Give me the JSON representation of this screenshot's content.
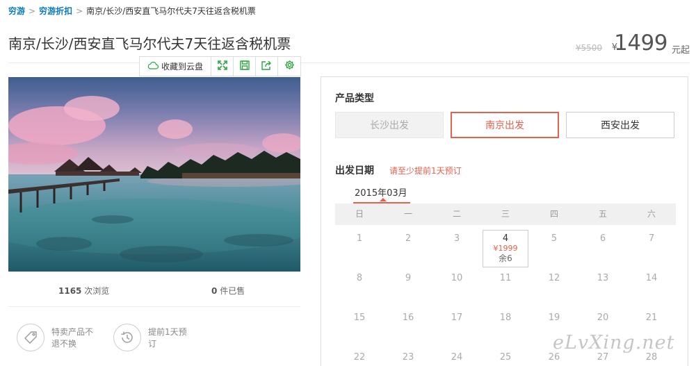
{
  "breadcrumb": {
    "items": [
      "穷游",
      "穷游折扣"
    ],
    "separator": ">",
    "current": "南京/长沙/西安直飞马尔代夫7天往返含税机票"
  },
  "product": {
    "title": "南京/长沙/西安直飞马尔代夫7天往返含税机票",
    "old_price": "¥5500",
    "currency": "¥",
    "price": "1499",
    "unit": "元起"
  },
  "toolbar": {
    "save_cloud": "收藏到云盘"
  },
  "stats": {
    "views_count": "1165",
    "views_label": "次浏览",
    "sold_count": "0",
    "sold_label": "件已售"
  },
  "features": [
    {
      "text": "特卖产品不退不换"
    },
    {
      "text": "提前1天预订"
    }
  ],
  "booking": {
    "type_label": "产品类型",
    "types": [
      "长沙出发",
      "南京出发",
      "西安出发"
    ],
    "date_label": "出发日期",
    "date_hint": "请至少提前1天预订",
    "month": "2015年03月",
    "weekdays": [
      "日",
      "一",
      "二",
      "三",
      "四",
      "五",
      "六"
    ],
    "weeks": [
      [
        "1",
        "2",
        "3",
        "4",
        "5",
        "6",
        "7"
      ],
      [
        "8",
        "9",
        "10",
        "11",
        "12",
        "13",
        "14"
      ],
      [
        "15",
        "16",
        "17",
        "18",
        "19",
        "20",
        "21"
      ],
      [
        "22",
        "23",
        "24",
        "25",
        "26",
        "27",
        "28"
      ]
    ],
    "available": {
      "day": "4",
      "price": "¥1999",
      "remaining": "余6"
    }
  },
  "watermark": "eLvXing.net",
  "colors": {
    "accent": "#e8604c",
    "link": "#0a7ab8"
  }
}
